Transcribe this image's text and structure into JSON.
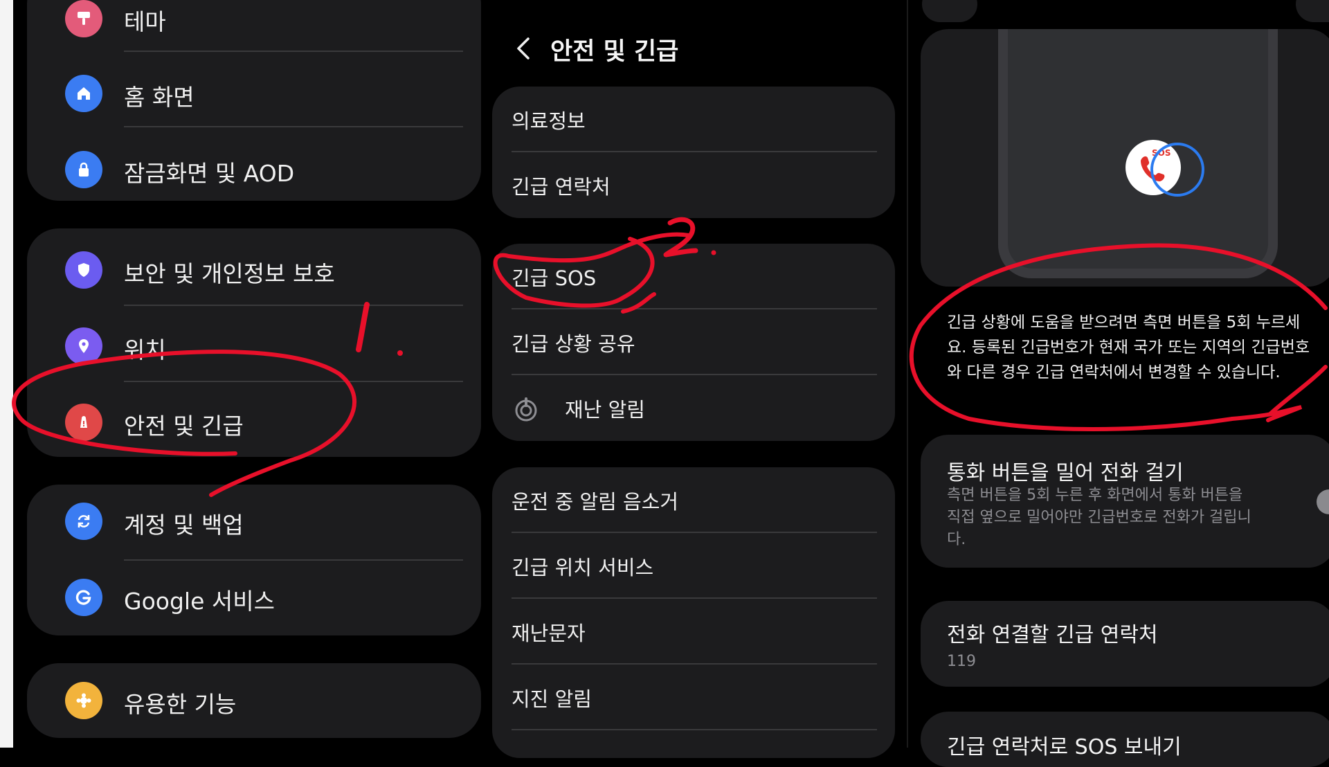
{
  "settings_list": {
    "items": [
      {
        "label": "테마",
        "icon": "theme-icon",
        "color": "#e35b7a"
      },
      {
        "label": "홈 화면",
        "icon": "home-icon",
        "color": "#3b7cf2"
      },
      {
        "label": "잠금화면 및 AOD",
        "icon": "lock-icon",
        "color": "#3b7cf2"
      },
      {
        "label": "보안 및 개인정보 보호",
        "icon": "shield-icon",
        "color": "#6b5cf0"
      },
      {
        "label": "위치",
        "icon": "location-pin-icon",
        "color": "#7b5cf0"
      },
      {
        "label": "안전 및 긴급",
        "icon": "emergency-icon",
        "color": "#e04848"
      },
      {
        "label": "계정 및 백업",
        "icon": "sync-icon",
        "color": "#3b7cf2"
      },
      {
        "label": "Google 서비스",
        "icon": "google-icon",
        "color": "#3b7cf2"
      },
      {
        "label": "유용한 기능",
        "icon": "puzzle-icon",
        "color": "#f2b33c"
      }
    ]
  },
  "safety_menu": {
    "title": "안전 및 긴급",
    "group1": [
      "의료정보",
      "긴급 연락처"
    ],
    "group2": [
      "긴급 SOS",
      "긴급 상황 공유",
      "재난 알림"
    ],
    "group3": [
      "운전 중 알림 음소거",
      "긴급 위치 서비스",
      "재난문자",
      "지진 알림"
    ]
  },
  "sos_detail": {
    "sos_badge": "SOS",
    "description": "긴급 상황에 도움을 받으려면 측면 버튼을 5회 누르세요. 등록된 긴급번호가 현재 국가 또는 지역의 긴급번호와 다른 경우 긴급 연락처에서 변경할 수 있습니다.",
    "swipe_call": {
      "title": "통화 버튼을 밀어 전화 걸기",
      "subtitle": "측면 버튼을 5회 누른 후 화면에서 통화 버튼을 직접 옆으로 밀어야만 긴급번호로 전화가 걸립니다.",
      "enabled": true
    },
    "emergency_contact": {
      "title": "전화 연결할 긴급 연락처",
      "value": "119"
    },
    "send_sos": {
      "title": "긴급 연락처로 SOS 보내기"
    }
  },
  "annotations": {
    "step1": "1.",
    "step2": "2.",
    "color": "#e8102a"
  },
  "colors": {
    "background": "#000000",
    "card": "#1c1c1e",
    "toggle_off": "#8a8a8e",
    "accent_ring": "#2b7bf0"
  }
}
